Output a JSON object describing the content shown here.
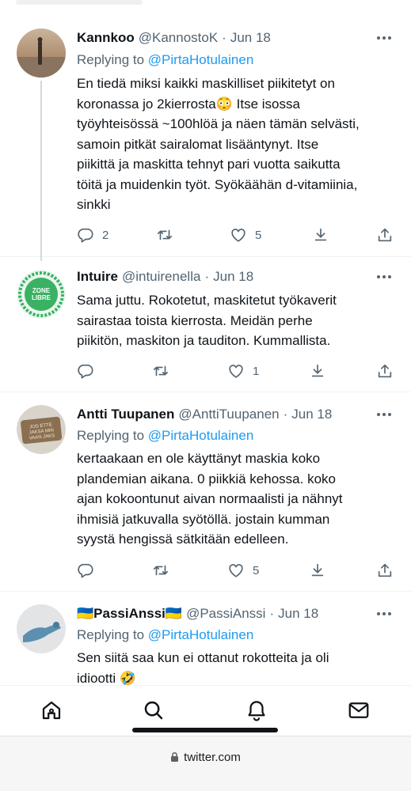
{
  "tweets": [
    {
      "name": "Kannkoo",
      "handle": "@KannostoK",
      "date": "Jun 18",
      "replying_prefix": "Replying to ",
      "replying_to": "@PirtaHotulainen",
      "text_lines": [
        "En tiedä miksi kaikki maskilliset piikitetyt on",
        "koronassa jo 2kierrosta😳 Itse isossa",
        "työyhteisössä ~100hlöä ja näen tämän selvästi,",
        "samoin pitkät sairalomat lisääntynyt. Itse",
        "piikittä ja maskitta tehnyt pari vuotta saikutta",
        "töitä ja muidenkin työt. Syökäähän d-vitamiinia,",
        "sinkki"
      ],
      "replies": "2",
      "retweets": "",
      "likes": "5"
    },
    {
      "name": "Intuire",
      "handle": "@intuirenella",
      "date": "Jun 18",
      "avatar_text": "ZONE LIBRE",
      "text_lines": [
        "Sama juttu. Rokotetut, maskitetut työkaverit",
        "sairastaa toista kierrosta. Meidän perhe",
        "piikitön, maskiton ja tauditon. Kummallista."
      ],
      "replies": "",
      "retweets": "",
      "likes": "1"
    },
    {
      "name": "Antti Tuupanen",
      "handle": "@AnttiTuupanen",
      "date": "Jun 18",
      "avatar_text": "JOS ETTE JAKSA MIN MUT TAKSA VAAN JAKS",
      "replying_prefix": "Replying to ",
      "replying_to": "@PirtaHotulainen",
      "text_lines": [
        "kertaakaan en ole käyttänyt maskia koko",
        "plandemian aikana. 0 piikkiä kehossa. koko",
        "ajan kokoontunut aivan normaalisti ja nähnyt",
        "ihmisiä jatkuvalla syötöllä. jostain kumman",
        "syystä hengissä sätkitään edelleen."
      ],
      "replies": "",
      "retweets": "",
      "likes": "5"
    },
    {
      "name": "🇺🇦PassiAnssi🇺🇦",
      "handle": "@PassiAnssi",
      "date": "Jun 18",
      "replying_prefix": "Replying to ",
      "replying_to": "@PirtaHotulainen",
      "text_lines": [
        "Sen siitä saa kun ei ottanut rokotteita ja oli",
        "idiootti 🤣"
      ]
    }
  ],
  "bottom_nav": [
    "home-icon",
    "search-icon",
    "notifications-icon",
    "messages-icon"
  ],
  "browser": {
    "url": "twitter.com"
  },
  "colors": {
    "link": "#1d9bf0",
    "secondary": "#536471",
    "primary": "#0f1419"
  }
}
